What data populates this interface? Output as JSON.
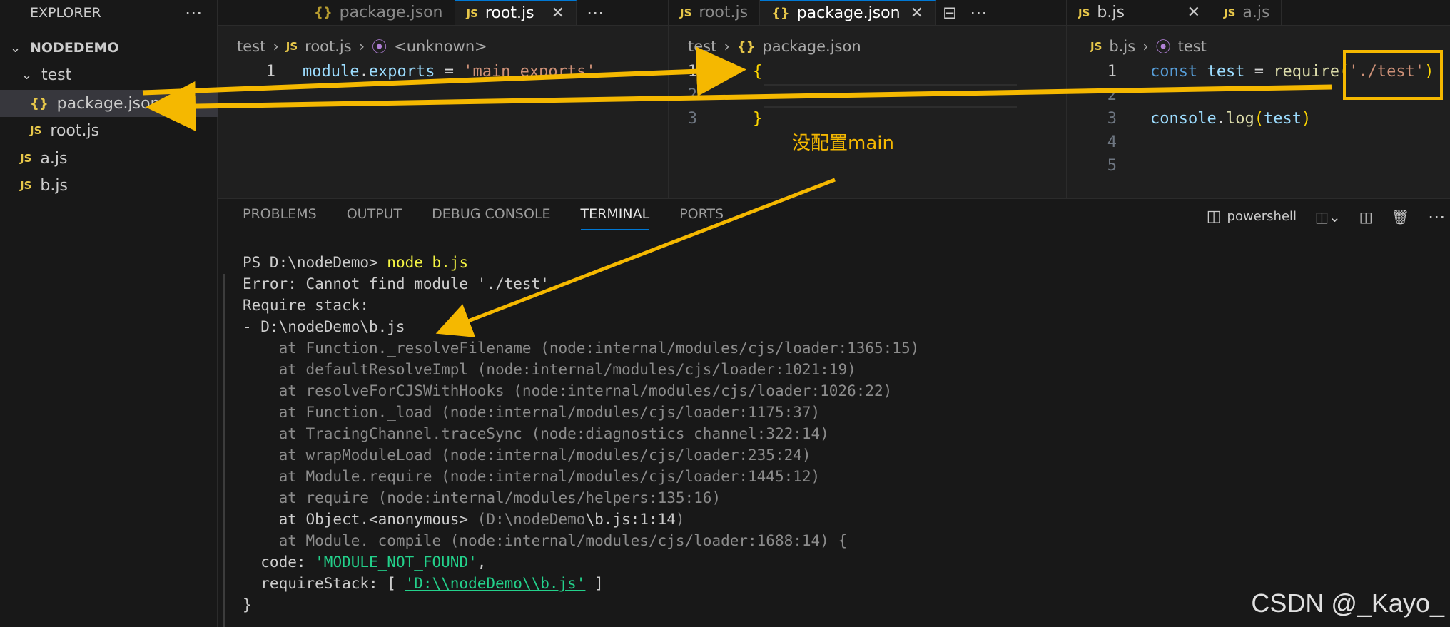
{
  "explorer": {
    "title": "EXPLORER",
    "more_icon": "ellipsis-icon",
    "root_folder": "NODEDEMO",
    "items": [
      {
        "label": "test",
        "kind": "folder"
      },
      {
        "label": "package.json",
        "kind": "json"
      },
      {
        "label": "root.js",
        "kind": "js"
      },
      {
        "label": "a.js",
        "kind": "js"
      },
      {
        "label": "b.js",
        "kind": "js"
      }
    ]
  },
  "icons": {
    "json": "{ }",
    "js": "JS",
    "chevron_down": "⌄",
    "close": "✕"
  },
  "group1": {
    "tabs": [
      {
        "label": "package.json",
        "icon": "{ }",
        "active": false
      },
      {
        "label": "root.js",
        "icon": "JS",
        "active": true
      }
    ],
    "breadcrumb": [
      "test",
      "root.js",
      "<unknown>"
    ],
    "lines": [
      {
        "n": "1",
        "code": "module.exports = 'main exports'"
      }
    ]
  },
  "group2": {
    "tabs": [
      {
        "label": "root.js",
        "icon": "JS",
        "active": false
      },
      {
        "label": "package.json",
        "icon": "{ }",
        "active": true
      }
    ],
    "breadcrumb": [
      "test",
      "package.json"
    ],
    "lines": [
      {
        "n": "1",
        "code": "{"
      },
      {
        "n": "2",
        "code": ""
      },
      {
        "n": "3",
        "code": "}"
      }
    ]
  },
  "group3": {
    "tabs": [
      {
        "label": "b.js",
        "icon": "JS",
        "active": false
      },
      {
        "label": "a.js",
        "icon": "JS",
        "active": false
      }
    ],
    "breadcrumb": [
      "b.js",
      "test"
    ],
    "lines": [
      {
        "n": "1",
        "code": "const test = require('./test')"
      },
      {
        "n": "2",
        "code": ""
      },
      {
        "n": "3",
        "code": "console.log(test)"
      },
      {
        "n": "4",
        "code": ""
      },
      {
        "n": "5",
        "code": ""
      }
    ]
  },
  "panel": {
    "tabs": [
      "PROBLEMS",
      "OUTPUT",
      "DEBUG CONSOLE",
      "TERMINAL",
      "PORTS"
    ],
    "active_tab": "TERMINAL",
    "shell": "powershell"
  },
  "terminal": {
    "prompt": "PS D:\\nodeDemo> ",
    "command": "node b.js",
    "error_lines": [
      "Error: Cannot find module './test'",
      "Require stack:",
      "- D:\\nodeDemo\\b.js"
    ],
    "stack": [
      "    at Function._resolveFilename (node:internal/modules/cjs/loader:1365:15)",
      "    at defaultResolveImpl (node:internal/modules/cjs/loader:1021:19)",
      "    at resolveForCJSWithHooks (node:internal/modules/cjs/loader:1026:22)",
      "    at Function._load (node:internal/modules/cjs/loader:1175:37)",
      "    at TracingChannel.traceSync (node:diagnostics_channel:322:14)",
      "    at wrapModuleLoad (node:internal/modules/cjs/loader:235:24)",
      "    at Module.require (node:internal/modules/cjs/loader:1445:12)",
      "    at require (node:internal/modules/helpers:135:16)"
    ],
    "anon_line": {
      "prefix": "    at Object.<anonymous> ",
      "path_dim": "(D:\\nodeDemo",
      "path_bright": "\\b.js:1:14",
      "suffix": ")"
    },
    "compile_line": "    at Module._compile (node:internal/modules/cjs/loader:1688:14) {",
    "code_key": "  code: ",
    "code_val": "'MODULE_NOT_FOUND'",
    "code_end": ",",
    "rs_key": "  requireStack: [ ",
    "rs_val": "'D:\\\\nodeDemo\\\\b.js'",
    "rs_end": " ]",
    "close": "}"
  },
  "annotation": {
    "text": "没配置main",
    "color": "#f5b800"
  },
  "watermark": "CSDN @_Kayo_"
}
